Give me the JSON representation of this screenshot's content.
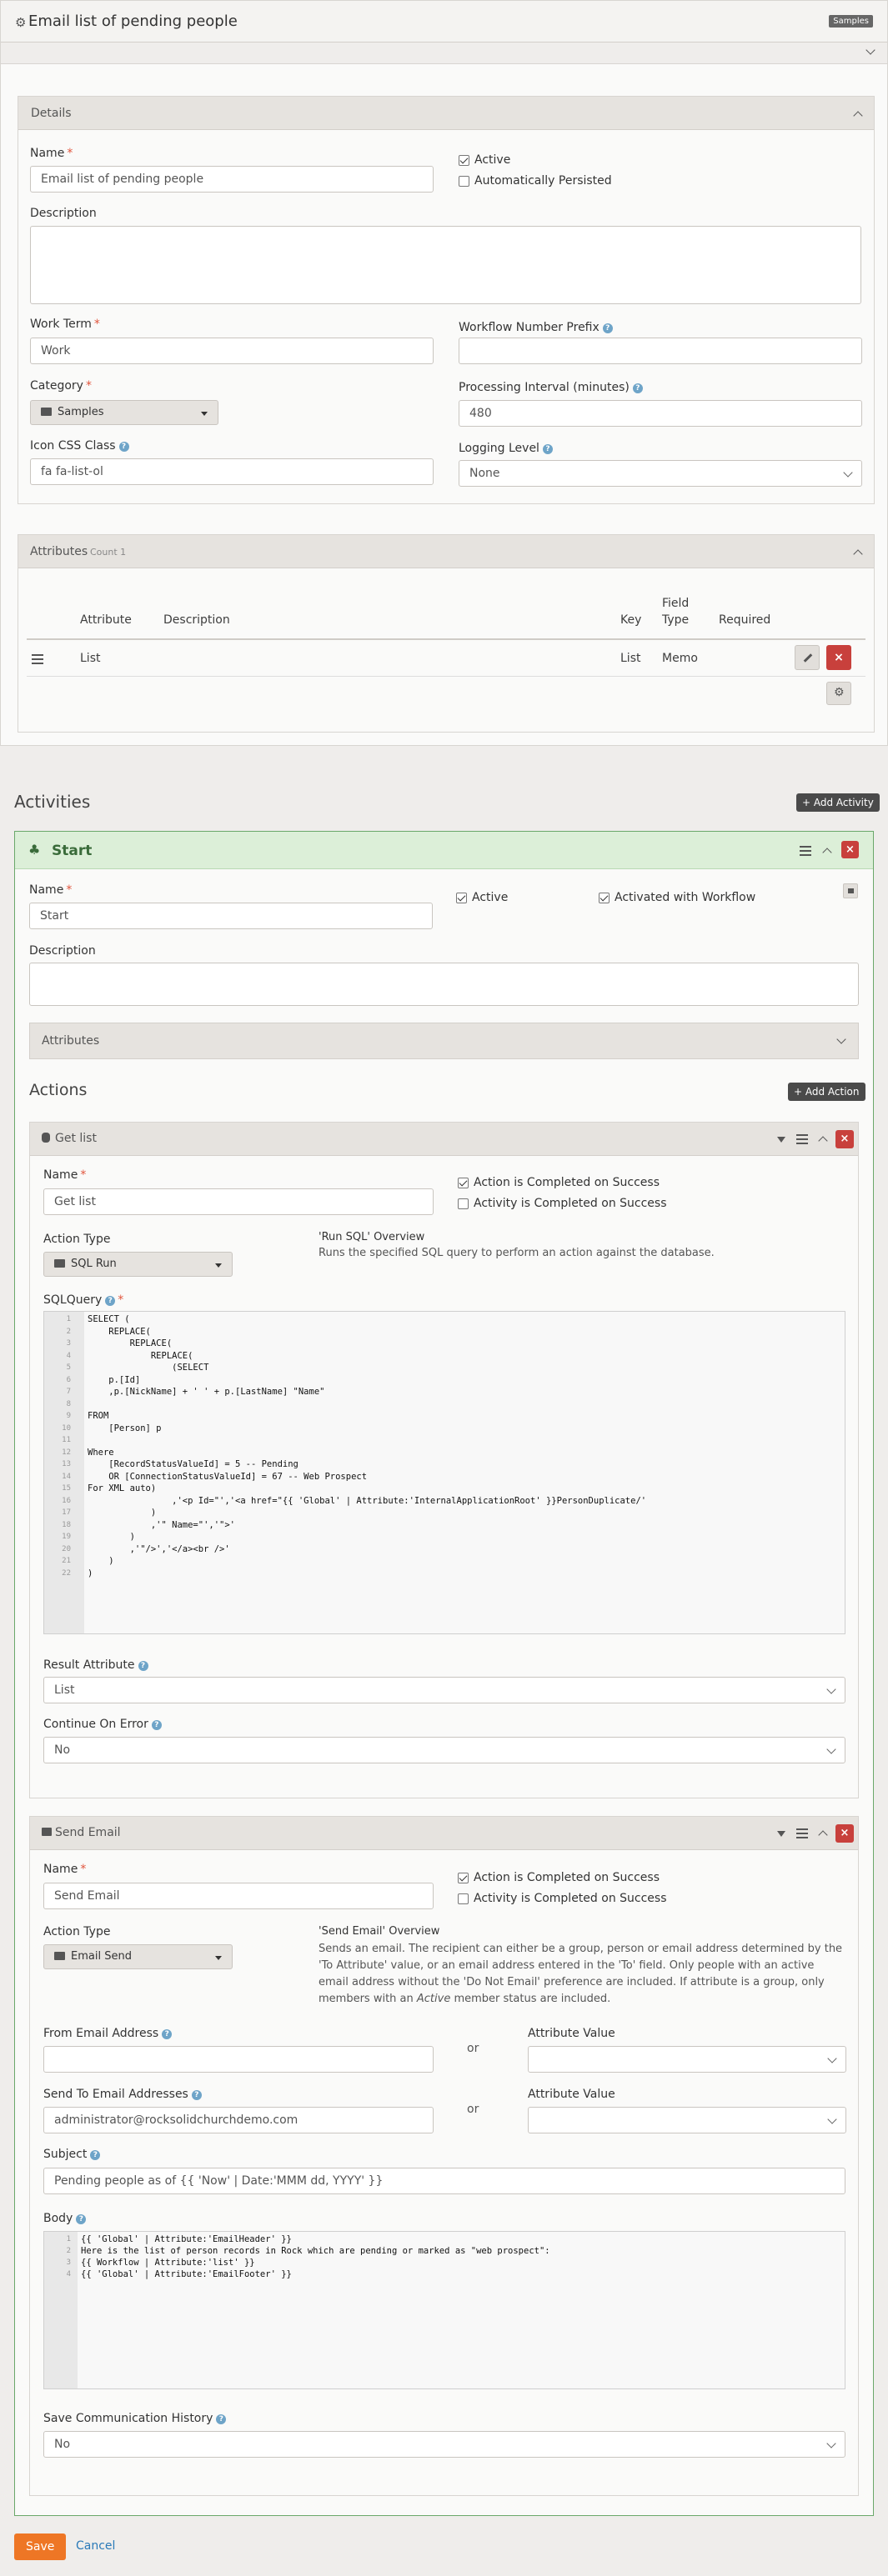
{
  "page": {
    "title": "Email list of pending people",
    "badge": "Samples"
  },
  "details": {
    "header": "Details",
    "name_label": "Name",
    "name_value": "Email list of pending people",
    "active_label": "Active",
    "auto_persist_label": "Automatically Persisted",
    "description_label": "Description",
    "work_term_label": "Work Term",
    "work_term_value": "Work",
    "wf_prefix_label": "Workflow Number Prefix",
    "wf_prefix_value": "",
    "category_label": "Category",
    "category_value": "Samples",
    "interval_label": "Processing Interval (minutes)",
    "interval_value": "480",
    "icon_label": "Icon CSS Class",
    "icon_value": "fa fa-list-ol",
    "logging_label": "Logging Level",
    "logging_value": "None"
  },
  "attributes": {
    "header": "Attributes",
    "count": "Count 1",
    "columns": {
      "attribute": "Attribute",
      "description": "Description",
      "key": "Key",
      "field_type": "Field Type",
      "required": "Required"
    },
    "rows": [
      {
        "attribute": "List",
        "description": "",
        "key": "List",
        "field_type": "Memo",
        "required": ""
      }
    ]
  },
  "activities": {
    "title": "Activities",
    "add_button": "+ Add Activity",
    "start": {
      "header": "Start",
      "name_label": "Name",
      "name_value": "Start",
      "active_label": "Active",
      "activated_label": "Activated with Workflow",
      "description_label": "Description",
      "attributes_label": "Attributes",
      "actions_title": "Actions",
      "add_action": "+ Add Action"
    }
  },
  "action1": {
    "header": "Get list",
    "name_label": "Name",
    "name_value": "Get list",
    "completed_label": "Action is Completed on Success",
    "activity_completed_label": "Activity is Completed on Success",
    "type_label": "Action Type",
    "type_value": "SQL Run",
    "overview_title": "'Run SQL' Overview",
    "overview_text": "Runs the specified SQL query to perform an action against the database.",
    "sql_label": "SQLQuery",
    "sql_lines": [
      "SELECT (",
      "    REPLACE(",
      "        REPLACE(",
      "            REPLACE(",
      "                (SELECT",
      "    p.[Id]",
      "    ,p.[NickName] + ' ' + p.[LastName] \"Name\"",
      "",
      "FROM",
      "    [Person] p",
      "",
      "Where",
      "    [RecordStatusValueId] = 5 -- Pending",
      "    OR [ConnectionStatusValueId] = 67 -- Web Prospect",
      "For XML auto)",
      "                ,'<p Id=\"','<a href=\"{{ 'Global' | Attribute:'InternalApplicationRoot' }}PersonDuplicate/'",
      "            )",
      "            ,'\" Name=\"','\">'",
      "        )",
      "        ,'\"/>','</a><br />'",
      "    )",
      ")"
    ],
    "result_label": "Result Attribute",
    "result_value": "List",
    "continue_label": "Continue On Error",
    "continue_value": "No"
  },
  "action2": {
    "header": "Send Email",
    "name_label": "Name",
    "name_value": "Send Email",
    "completed_label": "Action is Completed on Success",
    "activity_completed_label": "Activity is Completed on Success",
    "type_label": "Action Type",
    "type_value": "Email Send",
    "overview_title": "'Send Email' Overview",
    "overview_text_1": "Sends an email. The recipient can either be a group, person or email address determined by the 'To Attribute' value, or an email address entered in the 'To' field. Only people with an active email address without the 'Do Not Email' preference are included. If attribute is a group, only members with an ",
    "overview_em": "Active",
    "overview_text_2": " member status are included.",
    "from_label": "From Email Address",
    "from_value": "",
    "or": "or",
    "attr_value_label": "Attribute Value",
    "to_label": "Send To Email Addresses",
    "to_value": "administrator@rocksolidchurchdemo.com",
    "subject_label": "Subject",
    "subject_value": "Pending people as of {{ 'Now' | Date:'MMM dd, YYYY' }}",
    "body_label": "Body",
    "body_lines": [
      "{{ 'Global' | Attribute:'EmailHeader' }}",
      "Here is the list of person records in Rock which are pending or marked as \"web prospect\":",
      "{{ Workflow | Attribute:'list' }}",
      "{{ 'Global' | Attribute:'EmailFooter' }}"
    ],
    "save_history_label": "Save Communication History",
    "save_history_value": "No"
  },
  "footer": {
    "save": "Save",
    "cancel": "Cancel"
  }
}
